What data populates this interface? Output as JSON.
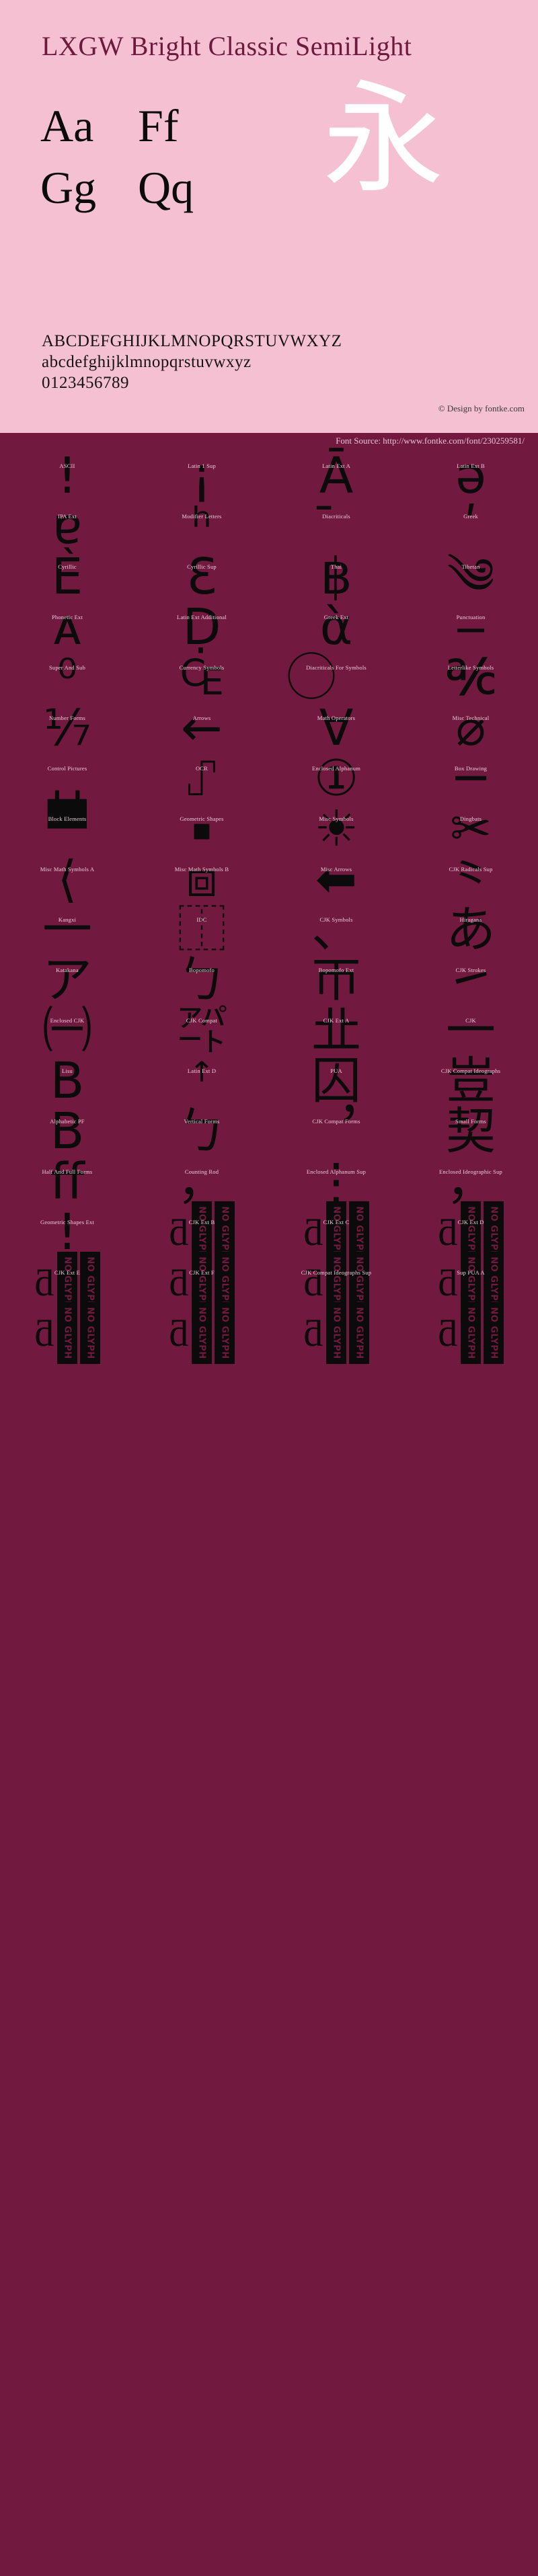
{
  "specimen": {
    "title": "LXGW Bright Classic SemiLight",
    "samples": [
      {
        "upper": "Aa",
        "lower": "Ff"
      },
      {
        "upper": "Gg",
        "lower": "Qq"
      }
    ],
    "watermark_glyph": "永",
    "alphabet_upper": "ABCDEFGHIJKLMNOPQRSTUVWXYZ",
    "alphabet_lower": "abcdefghijklmnopqrstuvwxyz",
    "digits": "0123456789",
    "copyright": "© Design by fontke.com",
    "source_label": "Font Source: http://www.fontke.com/font/230259581/"
  },
  "colors": {
    "panel_background": "#f5c0d2",
    "page_background": "#72193f",
    "title_color": "#6d1a3c",
    "glyph_color": "#0b0b0b",
    "label_color": "#e8cfd9",
    "watermark_color": "#ffffff"
  },
  "noglyph_label": "NO GLYPH",
  "blocks": [
    {
      "label": "ASCII",
      "glyph": "!",
      "size": "big"
    },
    {
      "label": "Latin 1 Sup",
      "glyph": "¡",
      "size": "big"
    },
    {
      "label": "Latin Ext A",
      "glyph": "Ā",
      "size": "big"
    },
    {
      "label": "Latin Ext B",
      "glyph": "ǝ",
      "size": "big"
    },
    {
      "label": "IPA Ext",
      "glyph": "ɐ",
      "size": "big"
    },
    {
      "label": "Modifier Letters",
      "glyph": "ʰ",
      "size": "big"
    },
    {
      "label": "Diacriticals",
      "glyph": "̄",
      "size": "big"
    },
    {
      "label": "Greek",
      "glyph": "ʹ",
      "size": "big"
    },
    {
      "label": "Cyrillic",
      "glyph": "Ѐ",
      "size": "big"
    },
    {
      "label": "Cyrillic Sup",
      "glyph": "Ԑ",
      "size": "big"
    },
    {
      "label": "Thai",
      "glyph": "฿",
      "size": "big"
    },
    {
      "label": "Tibetan",
      "glyph": "༄",
      "size": "big"
    },
    {
      "label": "Phonetic Ext",
      "glyph": "ᴀ",
      "size": "big"
    },
    {
      "label": "Latin Ext Additional",
      "glyph": "Ḍ",
      "size": "big"
    },
    {
      "label": "Greek Ext",
      "glyph": "ὰ",
      "size": "big"
    },
    {
      "label": "Punctuation",
      "glyph": "‒",
      "size": "big"
    },
    {
      "label": "Super And Sub",
      "glyph": "⁰",
      "size": "big"
    },
    {
      "label": "Currency Symbols",
      "glyph": "₠",
      "size": "big"
    },
    {
      "label": "Diacriticals For Symbols",
      "glyph": "⃝",
      "size": "big"
    },
    {
      "label": "Letterlike Symbols",
      "glyph": "℀",
      "size": "big"
    },
    {
      "label": "Number Forms",
      "glyph": "⅐",
      "size": "big"
    },
    {
      "label": "Arrows",
      "glyph": "←",
      "size": "big"
    },
    {
      "label": "Math Operators",
      "glyph": "∀",
      "size": "big"
    },
    {
      "label": "Misc Technical",
      "glyph": "⌀",
      "size": "big"
    },
    {
      "label": "Control Pictures",
      "glyph": "␣",
      "size": "big"
    },
    {
      "label": "OCR",
      "glyph": "⑀",
      "size": "big"
    },
    {
      "label": "Enclosed Alphanum",
      "glyph": "①",
      "size": "big"
    },
    {
      "label": "Box Drawing",
      "glyph": "─",
      "size": "big"
    },
    {
      "label": "Block Elements",
      "glyph": "▀",
      "size": "big"
    },
    {
      "label": "Geometric Shapes",
      "glyph": "▪",
      "size": "small"
    },
    {
      "label": "Misc Symbols",
      "glyph": "☀",
      "size": "big"
    },
    {
      "label": "Dingbats",
      "glyph": "✂",
      "size": "big"
    },
    {
      "label": "Misc Math Symbols A",
      "glyph": "⟨",
      "size": "big"
    },
    {
      "label": "Misc Math Symbols B",
      "glyph": "⧈",
      "size": "big"
    },
    {
      "label": "Misc Arrows",
      "glyph": "⬅",
      "size": "big"
    },
    {
      "label": "CJK Radicals Sup",
      "glyph": "⺀",
      "size": "big"
    },
    {
      "label": "Kangxi",
      "glyph": "⼀",
      "size": "big"
    },
    {
      "label": "IDC",
      "glyph": "⿰",
      "size": "big"
    },
    {
      "label": "CJK Symbols",
      "glyph": "、",
      "size": "big"
    },
    {
      "label": "Hiragana",
      "glyph": "あ",
      "size": "big"
    },
    {
      "label": "Katakana",
      "glyph": "ア",
      "size": "big"
    },
    {
      "label": "Bopomofo",
      "glyph": "ㄅ",
      "size": "big"
    },
    {
      "label": "Bopomofo Ext",
      "glyph": "ㄭ",
      "size": "big"
    },
    {
      "label": "CJK Strokes",
      "glyph": "㇀",
      "size": "big"
    },
    {
      "label": "Enclosed CJK",
      "glyph": "㈠",
      "size": "big"
    },
    {
      "label": "CJK Compat",
      "glyph": "㌀",
      "size": "big"
    },
    {
      "label": "CJK Ext A",
      "glyph": "㐀",
      "size": "big"
    },
    {
      "label": "CJK",
      "glyph": "一",
      "size": "big"
    },
    {
      "label": "Lisu",
      "glyph": "ꓐ",
      "size": "big"
    },
    {
      "label": "Latin Ext D",
      "glyph": "ꜛ",
      "size": "big"
    },
    {
      "label": "PUA",
      "glyph": "囚",
      "size": "big"
    },
    {
      "label": "CJK Compat Ideographs",
      "glyph": "豈",
      "size": "big"
    },
    {
      "label": "Alphabetic PF",
      "glyph": "B",
      "size": "big"
    },
    {
      "label": "Vertical Forms",
      "glyph": "ㄅ",
      "size": "big"
    },
    {
      "label": "CJK Compat Forms",
      "glyph": "︐",
      "size": "big"
    },
    {
      "label": "Small Forms",
      "glyph": "契",
      "size": "big"
    },
    {
      "label": "Half And Full Forms",
      "glyph": "ﬀ",
      "size": "big"
    },
    {
      "label": "Counting Rod",
      "glyph": "，",
      "size": "big"
    },
    {
      "label": "Enclosed Alphanum Sup",
      "glyph": "⋮",
      "size": "big"
    },
    {
      "label": "Enclosed Ideographic Sup",
      "glyph": "，",
      "size": "big"
    },
    {
      "label": "Geometric Shapes Ext",
      "glyph": "!",
      "size": "big"
    },
    {
      "label": "CJK Ext B",
      "glyph": "NOGLYPH_MIX",
      "size": "big"
    },
    {
      "label": "CJK Ext C",
      "glyph": "NOGLYPH_MIX",
      "size": "big"
    },
    {
      "label": "CJK Ext D",
      "glyph": "NOGLYPH_MIX",
      "size": "big"
    },
    {
      "label": "CJK Ext E",
      "glyph": "NOGLYPH_MIX",
      "size": "big"
    },
    {
      "label": "CJK Ext F",
      "glyph": "NOGLYPH_MIX",
      "size": "big"
    },
    {
      "label": "CJK Compat Ideographs Sup",
      "glyph": "NOGLYPH_MIX",
      "size": "big"
    },
    {
      "label": "Sup PUA A",
      "glyph": "NOGLYPH_MIX",
      "size": "big"
    }
  ],
  "footer_glyph_row": [
    "NOGLYPH_MIX",
    "NOGLYPH_MIX",
    "NOGLYPH_MIX",
    "NOGLYPH_MIX"
  ]
}
